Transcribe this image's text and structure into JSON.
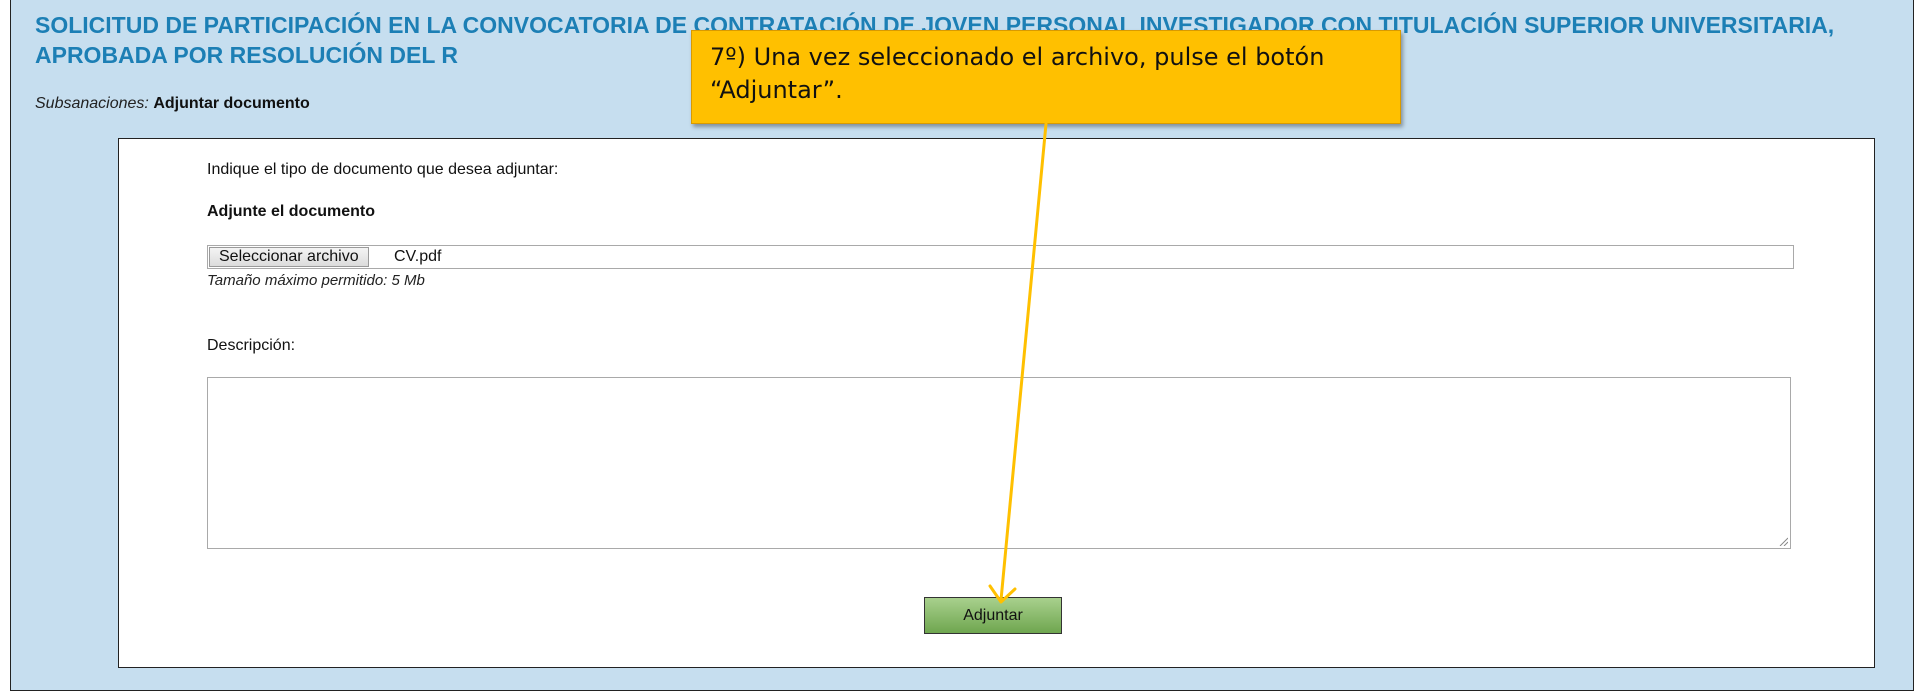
{
  "header": {
    "title": "SOLICITUD DE PARTICIPACIÓN EN LA CONVOCATORIA DE CONTRATACIÓN DE JOVEN PERSONAL INVESTIGADOR CON TITULACIÓN SUPERIOR UNIVERSITARIA, APROBADA POR RESOLUCIÓN DEL R"
  },
  "breadcrumb": {
    "label": "Subsanaciones:",
    "current": "Adjuntar documento"
  },
  "form": {
    "doc_type_prompt": "Indique el tipo de documento que desea adjuntar:",
    "attach_heading": "Adjunte el documento",
    "file_button_label": "Seleccionar archivo",
    "file_name": "CV.pdf",
    "max_size_hint": "Tamaño máximo permitido: 5 Mb",
    "description_label": "Descripción:",
    "description_value": "",
    "submit_label": "Adjuntar"
  },
  "callout": {
    "text": "7º) Una vez seleccionado el archivo, pulse el botón “Adjuntar”."
  },
  "colors": {
    "background": "#c6deef",
    "title": "#1c7fb5",
    "callout": "#ffc000",
    "submit_button": "#8bbf6a"
  }
}
